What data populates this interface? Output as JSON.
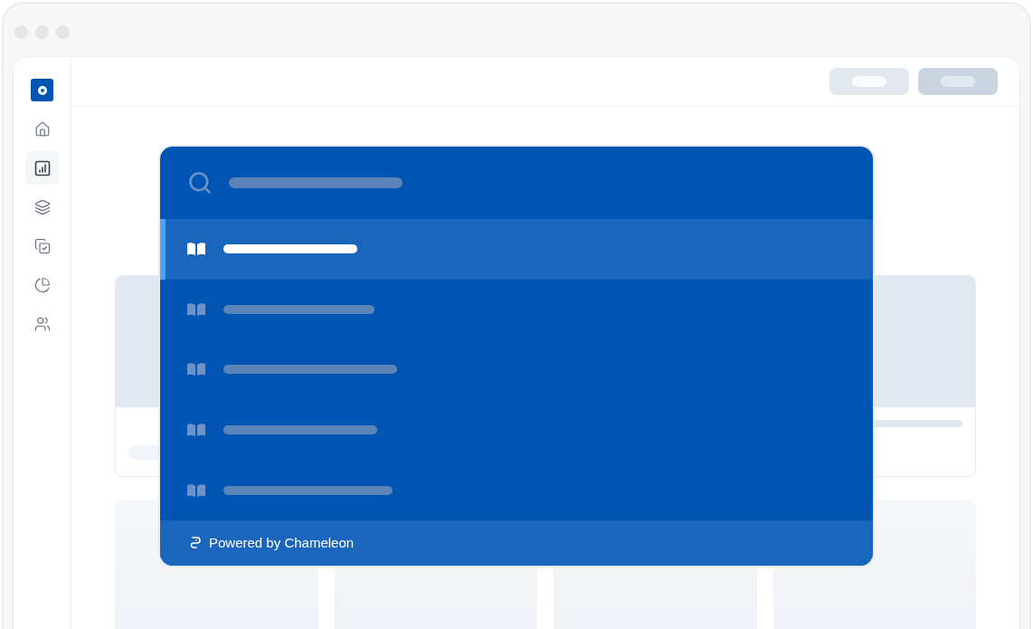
{
  "sidebar": {
    "items": [
      {
        "selected": false
      },
      {
        "selected": true
      },
      {
        "selected": false
      },
      {
        "selected": false
      },
      {
        "selected": false
      },
      {
        "selected": false
      }
    ]
  },
  "search_palette": {
    "results": [
      {
        "selected": true
      },
      {
        "selected": false
      },
      {
        "selected": false
      },
      {
        "selected": false
      },
      {
        "selected": false
      }
    ],
    "footer": "Powered by Chameleon"
  }
}
